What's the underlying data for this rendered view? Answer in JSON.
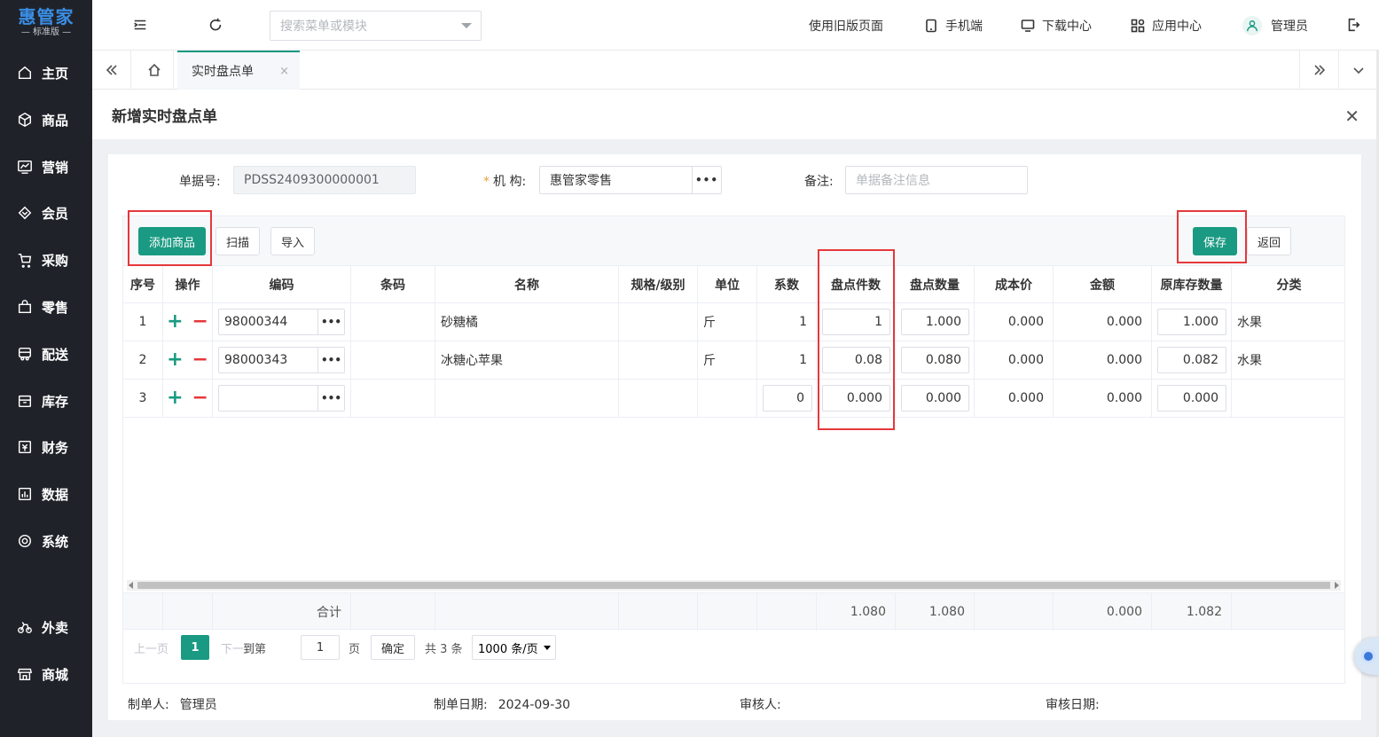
{
  "app": {
    "brand": "惠管家",
    "edition": "— 标准版 —"
  },
  "sidebar": {
    "items": [
      {
        "label": "主页",
        "icon": "home-icon"
      },
      {
        "label": "商品",
        "icon": "box-icon"
      },
      {
        "label": "营销",
        "icon": "chart-icon"
      },
      {
        "label": "会员",
        "icon": "diamond-icon"
      },
      {
        "label": "采购",
        "icon": "cart-icon"
      },
      {
        "label": "零售",
        "icon": "bag-icon"
      },
      {
        "label": "配送",
        "icon": "truck-icon"
      },
      {
        "label": "库存",
        "icon": "warehouse-icon"
      },
      {
        "label": "财务",
        "icon": "finance-icon"
      },
      {
        "label": "数据",
        "icon": "data-icon"
      },
      {
        "label": "系统",
        "icon": "settings-icon"
      },
      {
        "label": "外卖",
        "icon": "bike-icon"
      },
      {
        "label": "商城",
        "icon": "store-icon"
      }
    ]
  },
  "topbar": {
    "search_placeholder": "搜索菜单或模块",
    "old_page": "使用旧版页面",
    "mobile": "手机端",
    "download": "下载中心",
    "apps": "应用中心",
    "user": "管理员"
  },
  "tabs": {
    "active": "实时盘点单",
    "close": "×"
  },
  "page": {
    "title": "新增实时盘点单",
    "close": "✕",
    "form": {
      "doc_no_label": "单据号:",
      "doc_no_value": "PDSS2409300000001",
      "org_required": "*",
      "org_label": "机 构:",
      "org_value": "惠管家零售",
      "remark_label": "备注:",
      "remark_placeholder": "单据备注信息",
      "dots": "•••"
    },
    "toolbar": {
      "add": "添加商品",
      "scan": "扫描",
      "import": "导入",
      "save": "保存",
      "back": "返回"
    },
    "table": {
      "headers": [
        "序号",
        "操作",
        "编码",
        "条码",
        "名称",
        "规格/级别",
        "单位",
        "系数",
        "盘点件数",
        "盘点数量",
        "成本价",
        "金额",
        "原库存数量",
        "分类"
      ],
      "rows": [
        {
          "no": "1",
          "code": "98000344",
          "barcode": "",
          "name": "砂糖橘",
          "spec": "",
          "unit": "斤",
          "factor": "1",
          "pieces": "1",
          "qty": "1.000",
          "cost": "0.000",
          "amount": "0.000",
          "orig_qty": "1.000",
          "category": "水果"
        },
        {
          "no": "2",
          "code": "98000343",
          "barcode": "",
          "name": "冰糖心苹果",
          "spec": "",
          "unit": "斤",
          "factor": "1",
          "pieces": "0.08",
          "qty": "0.080",
          "cost": "0.000",
          "amount": "0.000",
          "orig_qty": "0.082",
          "category": "水果"
        },
        {
          "no": "3",
          "code": "",
          "barcode": "",
          "name": "",
          "spec": "",
          "unit": "",
          "factor": "0",
          "pieces": "0.000",
          "qty": "0.000",
          "cost": "0.000",
          "amount": "0.000",
          "orig_qty": "0.000",
          "category": ""
        }
      ],
      "plus": "+",
      "minus": "−",
      "footer": {
        "label": "合计",
        "pieces": "1.080",
        "qty": "1.080",
        "amount": "0.000",
        "orig_qty": "1.082"
      }
    },
    "pager": {
      "prev": "上一页",
      "current": "1",
      "next": "下一页",
      "goto": "到第",
      "page_value": "1",
      "page_unit": "页",
      "confirm": "确定",
      "total": "共 3 条",
      "page_size": "1000 条/页"
    },
    "meta": {
      "maker_label": "制单人:",
      "maker": "管理员",
      "date_label": "制单日期:",
      "date": "2024-09-30",
      "auditor_label": "审核人:",
      "auditor": "",
      "audit_date_label": "审核日期:",
      "audit_date": ""
    }
  },
  "colors": {
    "sidebar_bg": "#1f2329",
    "primary": "#1a9a82",
    "highlight": "#e5383b",
    "brand": "#3a8ee6"
  }
}
